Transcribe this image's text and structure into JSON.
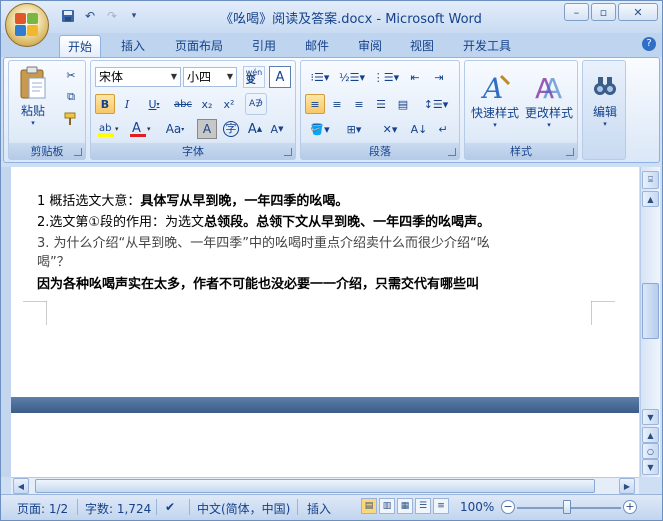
{
  "window": {
    "title": "《吆喝》阅读及答案.docx - Microsoft Word",
    "minimize": "–",
    "restore": "▫",
    "close": "✕"
  },
  "qat": {
    "save": "💾",
    "undo": "↶",
    "redo": "↷",
    "more": "▾"
  },
  "tabs": [
    "开始",
    "插入",
    "页面布局",
    "引用",
    "邮件",
    "审阅",
    "视图",
    "开发工具"
  ],
  "help": "?",
  "ribbon": {
    "clipboard": {
      "paste": "粘贴",
      "label": "剪贴板"
    },
    "font": {
      "name": "宋体",
      "size": "小四",
      "label": "字体",
      "bold": "B",
      "italic": "I",
      "underline": "U",
      "strike": "abc",
      "sub": "x₂",
      "sup": "x²",
      "wen": "wén\n变",
      "A": "A",
      "Aa": "Aa",
      "charA": "A",
      "circle": "字",
      "grow": "A",
      "shrink": "A"
    },
    "paragraph": {
      "label": "段落"
    },
    "styles": {
      "quick": "快速样式",
      "change": "更改样式",
      "label": "样式"
    },
    "edit": {
      "label": "编辑"
    }
  },
  "document": {
    "line1_prefix": "1 概括选文大意：",
    "line1_bold": "具体写从早到晚，一年四季的吆喝。",
    "line2_prefix": "2.选文第①段的作用：为选文",
    "line2_bold": "总领段。总领下文从早到晚、一年四季的吆喝声。",
    "line3": "3. 为什么介绍“从早到晚、一年四季”中的吆喝时重点介绍卖什么而很少介绍“吆",
    "line4": "喝”？",
    "line5": "因为各种吆喝声实在太多，作者不可能也没必要一一介绍，只需交代有哪些叫"
  },
  "status": {
    "page": "页面: 1/2",
    "words": "字数: 1,724",
    "lang": "中文(简体，中国)",
    "mode": "插入",
    "zoom": "100%",
    "zoom_level": 0.5
  }
}
